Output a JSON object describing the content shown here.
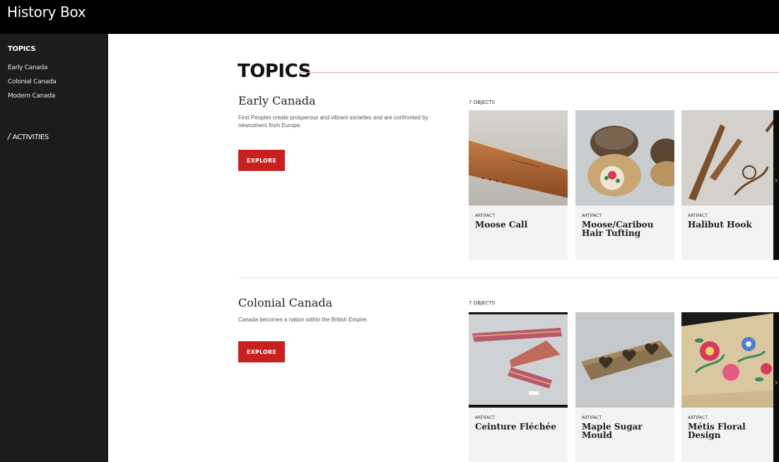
{
  "app": {
    "title": "History Box"
  },
  "sidebar": {
    "heading": "TOPICS",
    "items": [
      {
        "label": "Early Canada"
      },
      {
        "label": "Colonial Canada"
      },
      {
        "label": "Modern Canada"
      }
    ],
    "activities_label": "ACTIVITIES"
  },
  "main": {
    "title": "TOPICS",
    "sections": [
      {
        "name": "Early Canada",
        "description": "First Peoples create prosperous and vibrant societies and are confronted by newcomers from Europe.",
        "button_label": "EXPLORE",
        "object_count": "7 OBJECTS",
        "cards": [
          {
            "kind": "ARTIFACT",
            "title": "Moose Call"
          },
          {
            "kind": "ARTIFACT",
            "title": "Moose/Caribou Hair Tufting"
          },
          {
            "kind": "ARTIFACT",
            "title": "Halibut Hook"
          }
        ]
      },
      {
        "name": "Colonial Canada",
        "description": "Canada becomes a nation within the British Empire.",
        "button_label": "EXPLORE",
        "object_count": "7 OBJECTS",
        "cards": [
          {
            "kind": "ARTIFACT",
            "title": "Ceinture Fléchée"
          },
          {
            "kind": "ARTIFACT",
            "title": "Maple Sugar Mould"
          },
          {
            "kind": "ARTIFACT",
            "title": "Métis Floral Design"
          }
        ]
      }
    ]
  },
  "colors": {
    "accent": "#c8201e",
    "header": "#000000",
    "sidebar": "#1c1c1c",
    "title_rule": "#e8a7a4"
  }
}
